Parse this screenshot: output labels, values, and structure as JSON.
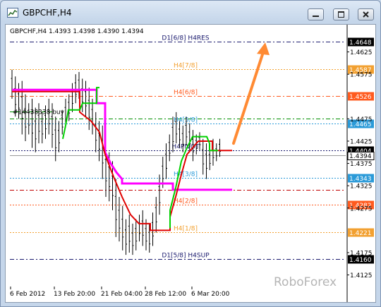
{
  "window": {
    "title": "GBPCHF,H4",
    "buttons": {
      "minimize": "minimize-icon",
      "maximize": "maximize-icon",
      "close": "close-icon"
    }
  },
  "chart": {
    "ohlc_label": "GBPCHF,H4  1.4393 1.4398 1.4390 1.4394",
    "order_label": "#14438338 buy",
    "watermark": "RoboForex",
    "colors": {
      "red": "#e00000",
      "green": "#00d000",
      "magenta": "#ff00ff",
      "arrow": "#ff8a33",
      "price": "#000000"
    }
  },
  "chart_data": {
    "type": "line",
    "price_range": [
      1.4099,
      1.4686
    ],
    "price_ticks": [
      "1.4625",
      "1.4575",
      "1.4475",
      "1.4425",
      "1.4375",
      "1.4325",
      "1.4275",
      "1.4175",
      "1.4125"
    ],
    "time_labels": [
      "6 Feb 2012",
      "13 Feb 20:00",
      "21 Feb 04:00",
      "28 Feb 12:00",
      "6 Mar 20:00"
    ],
    "levels": [
      {
        "label": "D1[6/8] H4RES",
        "price": 1.4648,
        "badge": "1.4648",
        "color": "#1a1a6e",
        "style": "dashdot",
        "badge_bg": "#000000"
      },
      {
        "label": "H4[7/8]",
        "price": 1.4587,
        "badge": "1.4587",
        "color": "#f2a030",
        "style": "dot",
        "badge_bg": "#f2a030"
      },
      {
        "label": "H4[6/8]",
        "price": 1.4526,
        "badge": "1.4526",
        "color": "#ff5a1e",
        "style": "dashdot",
        "badge_bg": "#ff5a1e"
      },
      {
        "label": "",
        "price": 1.4475,
        "badge": "",
        "color": "#009000",
        "style": "dashdot"
      },
      {
        "label": "H4[5/8]",
        "price": 1.4465,
        "badge": "1.4465",
        "color": "#2a9ad8",
        "style": "dot",
        "badge_bg": "#2a9ad8"
      },
      {
        "label": "H4PIVOT",
        "price": 1.4404,
        "badge": "1.4404",
        "color": "#1a1a6e",
        "style": "dot",
        "badge_bg": "#000000"
      },
      {
        "label": "H4[3/8]",
        "price": 1.4343,
        "badge": "1.4343",
        "color": "#2a9ad8",
        "style": "dot",
        "badge_bg": "#2a9ad8"
      },
      {
        "label": "",
        "price": 1.4316,
        "badge": "",
        "color": "#c00000",
        "style": "dashdot"
      },
      {
        "label": "H4[2/8]",
        "price": 1.4282,
        "badge": "1.4282",
        "color": "#ff5a1e",
        "style": "dot",
        "badge_bg": "#ff5a1e"
      },
      {
        "label": "H4[1/8]",
        "price": 1.4221,
        "badge": "1.4221",
        "color": "#f2a030",
        "style": "dot",
        "badge_bg": "#f2a030"
      },
      {
        "label": "D1[5/8] H4SUP",
        "price": 1.416,
        "badge": "1.4160",
        "color": "#1a1a6e",
        "style": "dashdot",
        "badge_bg": "#000000"
      }
    ],
    "current_price": {
      "value": 1.4394,
      "badge": "1.4394"
    },
    "order_price": 1.4491,
    "red_line": [
      [
        0,
        1.4536
      ],
      [
        24,
        1.4536
      ],
      [
        24,
        1.449
      ],
      [
        28,
        1.447
      ],
      [
        31,
        1.4445
      ],
      [
        33,
        1.4395
      ],
      [
        36,
        1.4345
      ],
      [
        39,
        1.43
      ],
      [
        42,
        1.426
      ],
      [
        45,
        1.424
      ],
      [
        49,
        1.424
      ],
      [
        49,
        1.4225
      ],
      [
        56,
        1.4225
      ],
      [
        56,
        1.4255
      ],
      [
        58,
        1.43
      ],
      [
        60,
        1.435
      ],
      [
        62,
        1.4395
      ],
      [
        66,
        1.4425
      ],
      [
        71,
        1.4425
      ],
      [
        71,
        1.4404
      ],
      [
        78,
        1.4404
      ]
    ],
    "green_line": [
      [
        18,
        1.443
      ],
      [
        19,
        1.446
      ],
      [
        20,
        1.4495
      ],
      [
        24,
        1.4495
      ],
      [
        25,
        1.451
      ],
      [
        30,
        1.451
      ],
      [
        30,
        1.4545
      ],
      [
        31,
        1.4545
      ]
    ],
    "green_line2": [
      [
        56,
        1.423
      ],
      [
        56,
        1.427
      ],
      [
        58,
        1.432
      ],
      [
        60,
        1.438
      ],
      [
        62,
        1.441
      ],
      [
        64,
        1.4435
      ],
      [
        69,
        1.4435
      ],
      [
        70,
        1.442
      ],
      [
        70,
        1.4404
      ],
      [
        73,
        1.4404
      ]
    ],
    "magenta_line": [
      [
        0,
        1.454
      ],
      [
        30,
        1.454
      ],
      [
        30,
        1.451
      ],
      [
        33,
        1.451
      ],
      [
        33,
        1.44
      ],
      [
        35,
        1.4375
      ],
      [
        37,
        1.4355
      ],
      [
        39,
        1.434
      ],
      [
        39,
        1.433
      ],
      [
        57,
        1.433
      ],
      [
        57,
        1.4316
      ],
      [
        78,
        1.4316
      ]
    ],
    "bars": [
      [
        1.4585,
        1.452
      ],
      [
        1.457,
        1.448
      ],
      [
        1.4555,
        1.4475
      ],
      [
        1.456,
        1.444
      ],
      [
        1.453,
        1.4425
      ],
      [
        1.451,
        1.444
      ],
      [
        1.452,
        1.441
      ],
      [
        1.45,
        1.44
      ],
      [
        1.451,
        1.442
      ],
      [
        1.449,
        1.442
      ],
      [
        1.4505,
        1.443
      ],
      [
        1.452,
        1.444
      ],
      [
        1.451,
        1.441
      ],
      [
        1.448,
        1.438
      ],
      [
        1.447,
        1.44
      ],
      [
        1.4495,
        1.444
      ],
      [
        1.452,
        1.4455
      ],
      [
        1.453,
        1.447
      ],
      [
        1.4555,
        1.449
      ],
      [
        1.4575,
        1.451
      ],
      [
        1.458,
        1.452
      ],
      [
        1.4565,
        1.449
      ],
      [
        1.456,
        1.448
      ],
      [
        1.4545,
        1.445
      ],
      [
        1.452,
        1.444
      ],
      [
        1.449,
        1.44
      ],
      [
        1.447,
        1.438
      ],
      [
        1.446,
        1.434
      ],
      [
        1.442,
        1.43
      ],
      [
        1.44,
        1.429
      ],
      [
        1.438,
        1.427
      ],
      [
        1.434,
        1.421
      ],
      [
        1.43,
        1.42
      ],
      [
        1.428,
        1.418
      ],
      [
        1.425,
        1.417
      ],
      [
        1.426,
        1.4175
      ],
      [
        1.424,
        1.417
      ],
      [
        1.425,
        1.418
      ],
      [
        1.426,
        1.42
      ],
      [
        1.427,
        1.419
      ],
      [
        1.425,
        1.418
      ],
      [
        1.424,
        1.4175
      ],
      [
        1.4265,
        1.419
      ],
      [
        1.43,
        1.422
      ],
      [
        1.435,
        1.426
      ],
      [
        1.439,
        1.432
      ],
      [
        1.442,
        1.434
      ],
      [
        1.444,
        1.438
      ],
      [
        1.448,
        1.44
      ],
      [
        1.449,
        1.442
      ],
      [
        1.447,
        1.441
      ],
      [
        1.446,
        1.44
      ],
      [
        1.448,
        1.4415
      ],
      [
        1.4465,
        1.44
      ],
      [
        1.445,
        1.438
      ],
      [
        1.444,
        1.4395
      ],
      [
        1.4445,
        1.4405
      ],
      [
        1.443,
        1.435
      ],
      [
        1.442,
        1.434
      ],
      [
        1.441,
        1.436
      ],
      [
        1.443,
        1.437
      ],
      [
        1.442,
        1.438
      ],
      [
        1.443,
        1.439
      ]
    ],
    "bars_start_index": 0,
    "bars_step": 1.26,
    "arrow": {
      "from": [
        1.442
      ],
      "to": [
        1.464
      ]
    }
  }
}
